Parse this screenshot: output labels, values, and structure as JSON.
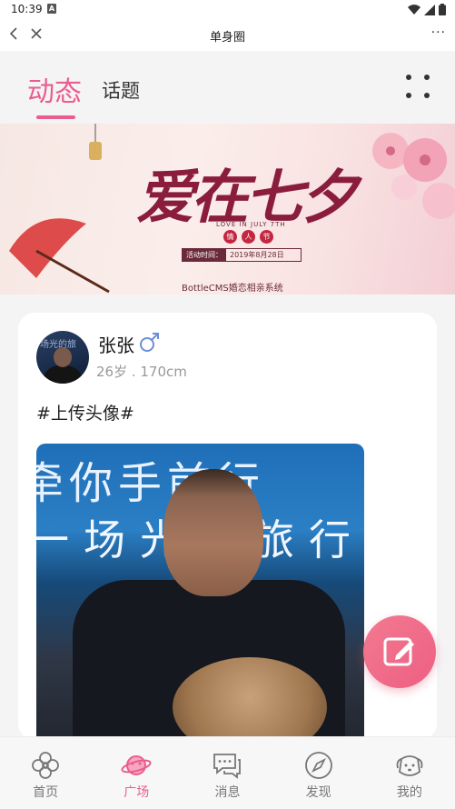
{
  "status_bar": {
    "time": "10:39",
    "notification_letter": "A"
  },
  "title_bar": {
    "title": "单身圈",
    "more": "···"
  },
  "tabs": {
    "active_label": "动态",
    "inactive_label": "话题",
    "accent_color": "#ea5d8f"
  },
  "banner": {
    "title": "爱在七夕",
    "subtitle": "LOVE IN JULY 7TH",
    "seal_chars": [
      "情",
      "人",
      "节"
    ],
    "date_label": "活动时间：",
    "date_value": "2019年8月28日",
    "footer": "BottleCMS婚恋相亲系统"
  },
  "post": {
    "user_name": "张张",
    "gender": "male",
    "user_meta": "26岁 . 170cm",
    "text": "#上传头像#",
    "avatar_overlay_text": "场光的旅",
    "photo_overlay_line1": "牵你手前行",
    "photo_overlay_line2": "一场光的旅行"
  },
  "fab": {
    "icon": "edit-icon"
  },
  "bottom_nav": {
    "items": [
      {
        "label": "首页",
        "icon": "flower-icon"
      },
      {
        "label": "广场",
        "icon": "planet-icon"
      },
      {
        "label": "消息",
        "icon": "chat-icon"
      },
      {
        "label": "发现",
        "icon": "compass-icon"
      },
      {
        "label": "我的",
        "icon": "dog-face-icon"
      }
    ],
    "active_index": 1,
    "active_color": "#ea5d8f",
    "inactive_color": "#777777"
  }
}
